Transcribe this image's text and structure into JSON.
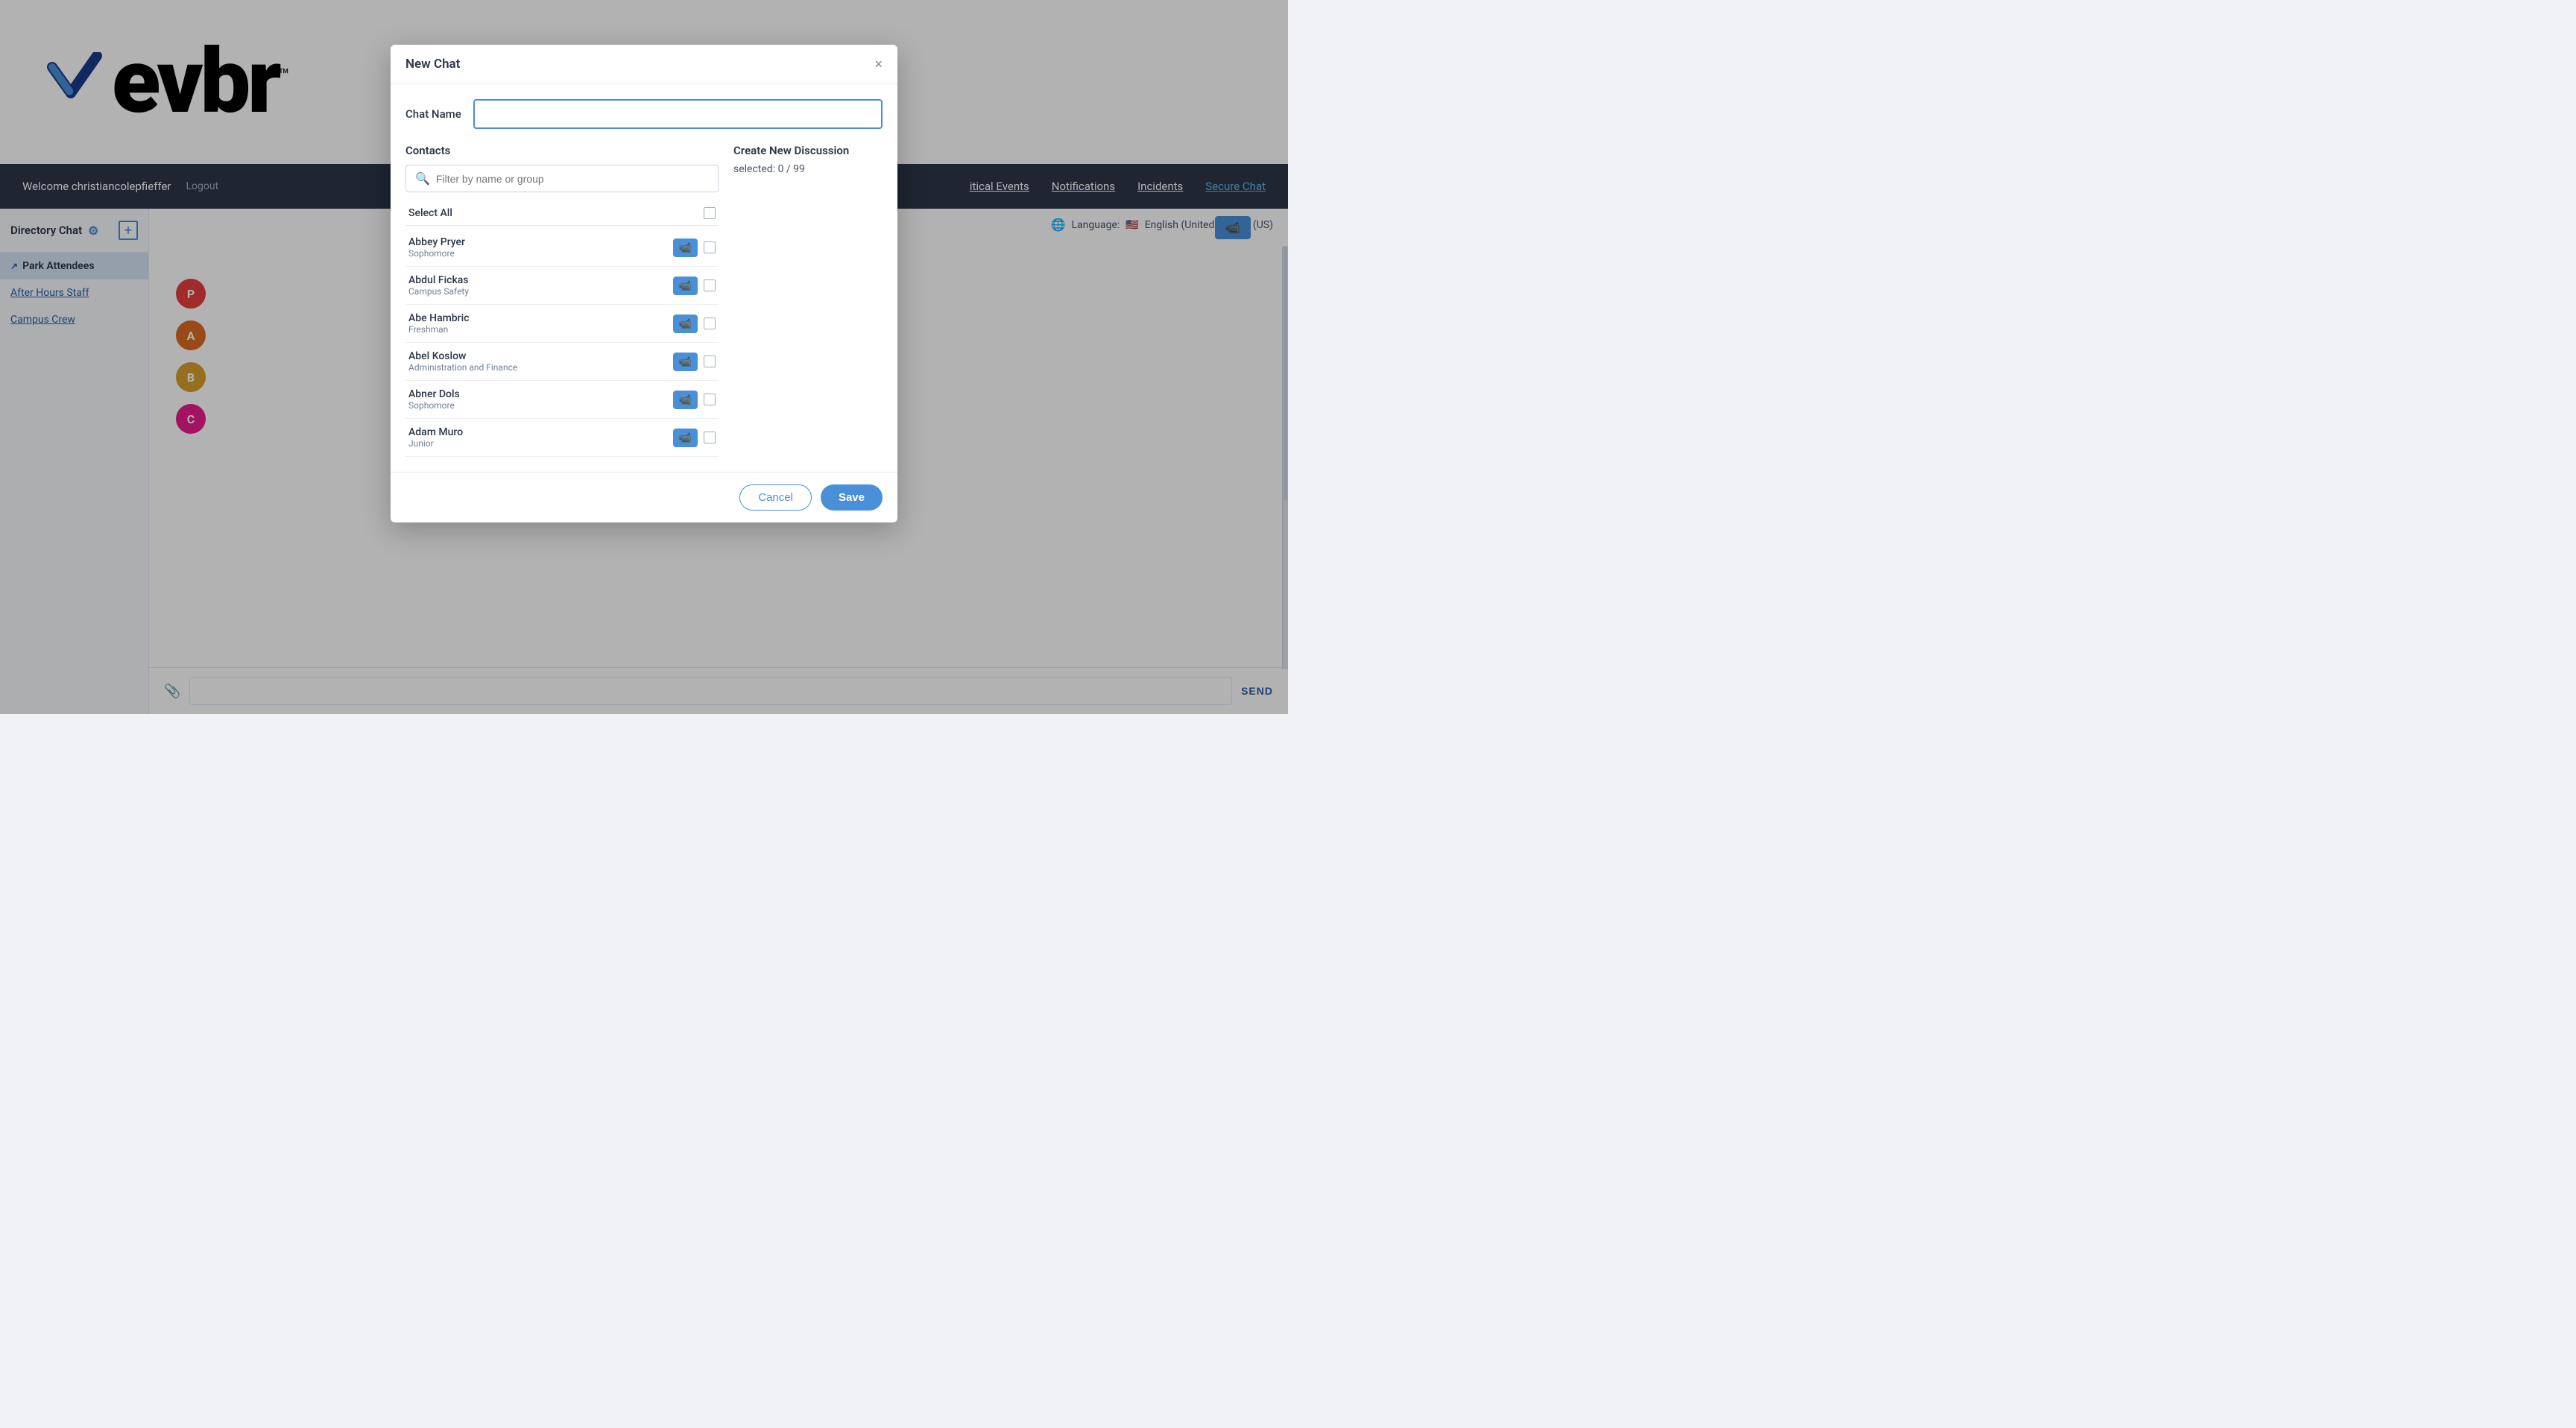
{
  "brand": {
    "text": "evbr",
    "tm": "™"
  },
  "topnav": {
    "welcome": "Welcome christiancolepfieffer",
    "logout": "Logout",
    "links": [
      {
        "label": "itical Events",
        "active": false
      },
      {
        "label": "Notifications",
        "active": false
      },
      {
        "label": "Incidents",
        "active": false
      },
      {
        "label": "Secure Chat",
        "active": true
      }
    ]
  },
  "sidebar": {
    "title": "Directory Chat",
    "items": [
      {
        "label": "Park Attendees",
        "active": true
      },
      {
        "label": "After Hours Staff",
        "active": false
      },
      {
        "label": "Campus Crew",
        "active": false
      }
    ]
  },
  "language": {
    "label": "Language:",
    "value": "English (United States) (US)"
  },
  "chat": {
    "send_label": "SEND",
    "input_placeholder": ""
  },
  "modal": {
    "title": "New Chat",
    "chat_name_label": "Chat Name",
    "chat_name_placeholder": "",
    "contacts_section": "Contacts",
    "search_placeholder": "Filter by name or group",
    "select_all": "Select All",
    "discussion_title": "Create New Discussion",
    "selected_text": "selected: 0 / 99",
    "contacts": [
      {
        "name": "Abbey Pryer",
        "group": "Sophomore"
      },
      {
        "name": "Abdul Fickas",
        "group": "Campus Safety"
      },
      {
        "name": "Abe Hambric",
        "group": "Freshman"
      },
      {
        "name": "Abel Koslow",
        "group": "Administration and Finance"
      },
      {
        "name": "Abner Dols",
        "group": "Sophomore"
      },
      {
        "name": "Adam Muro",
        "group": "Junior"
      }
    ],
    "cancel_label": "Cancel",
    "save_label": "Save"
  },
  "chat_list": {
    "items": [
      {
        "color": "#e53e3e"
      },
      {
        "color": "#dd6b20"
      },
      {
        "color": "#d69e2e"
      },
      {
        "color": "#e91e8c"
      }
    ]
  }
}
